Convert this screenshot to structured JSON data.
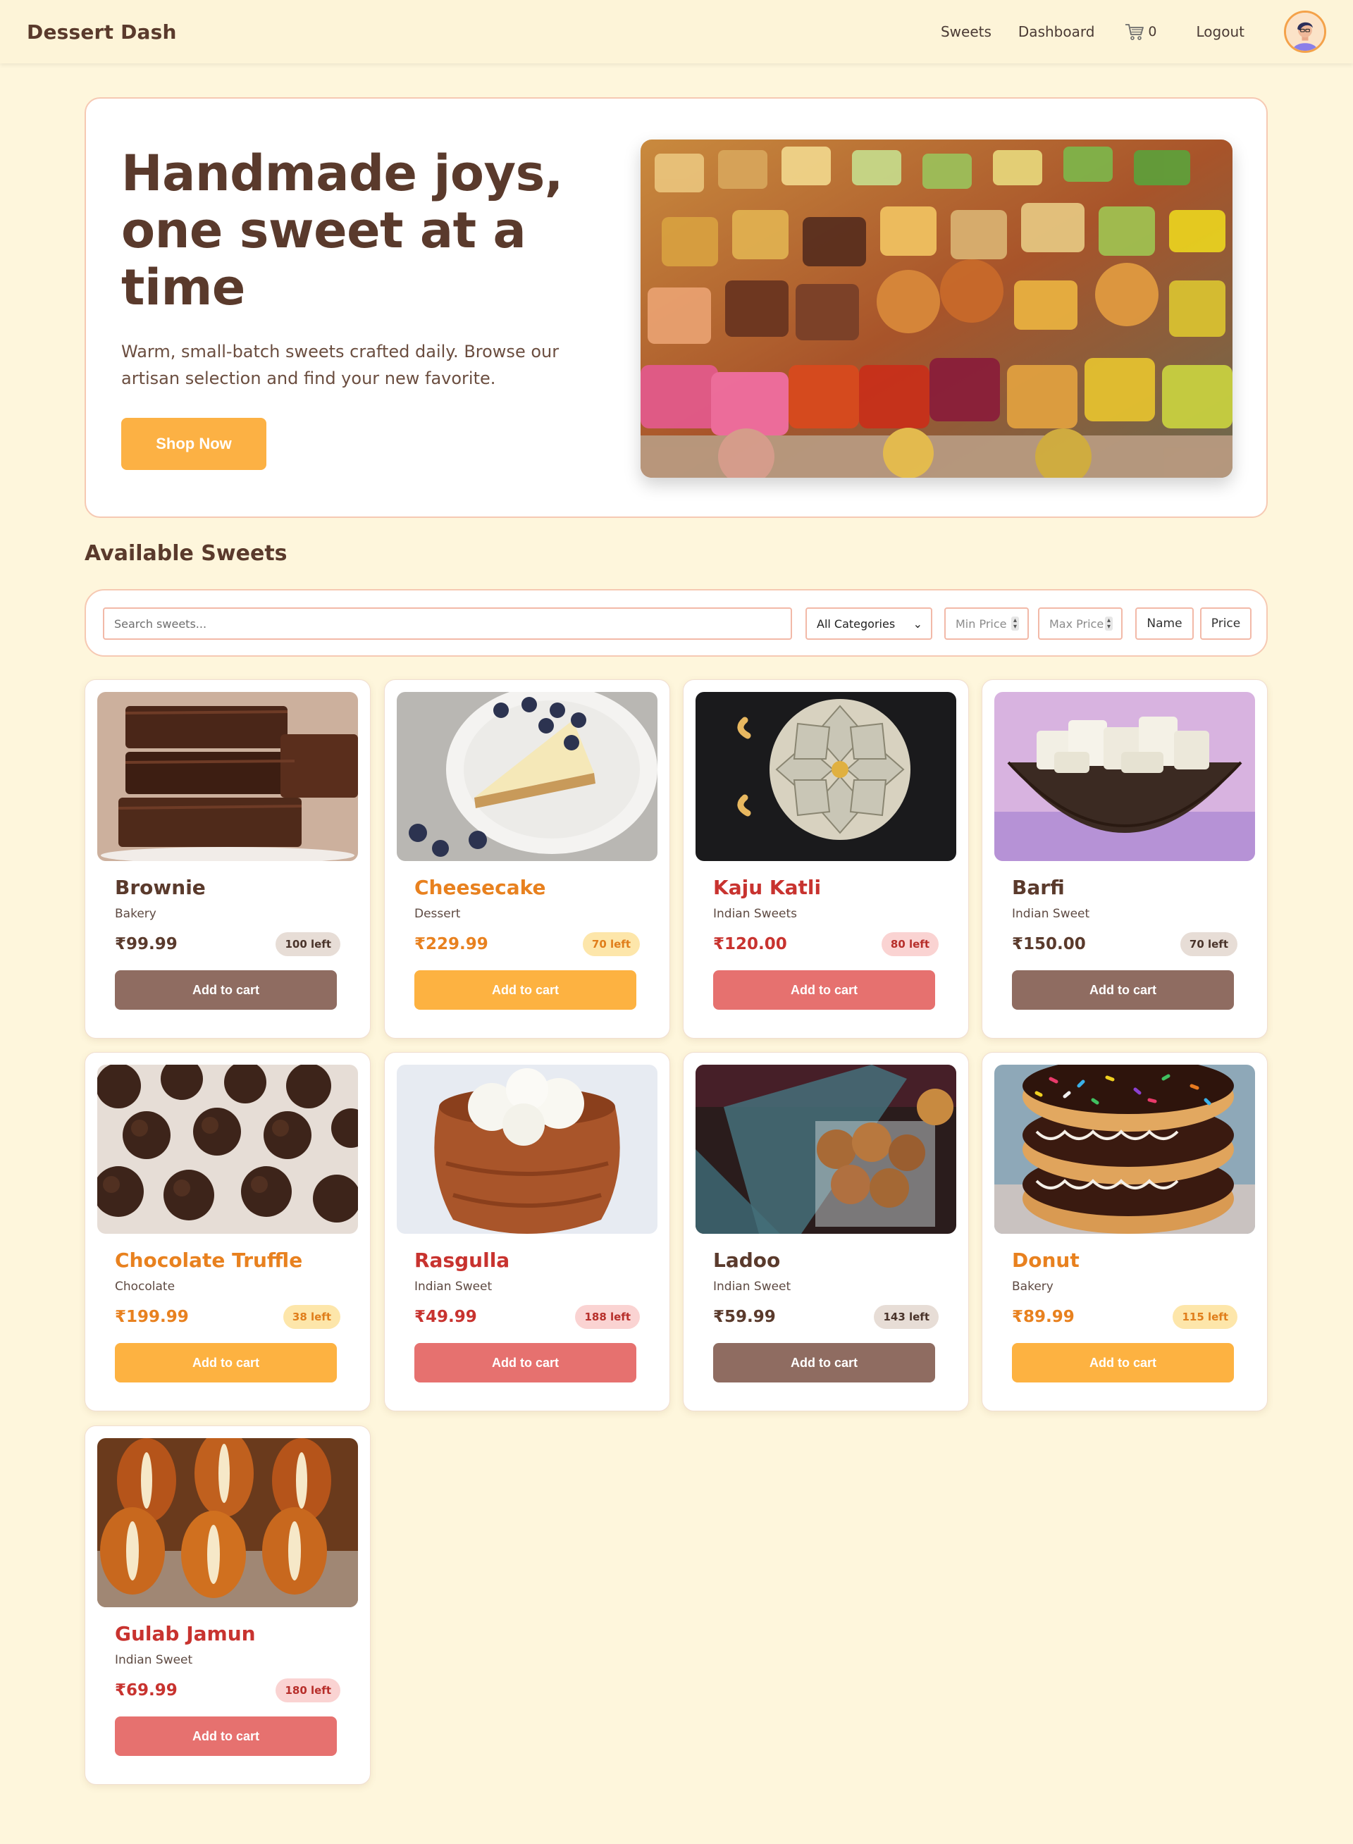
{
  "nav": {
    "brand": "Dessert Dash",
    "links": {
      "sweets": "Sweets",
      "dashboard": "Dashboard",
      "logout": "Logout"
    },
    "cart_count": "0",
    "cart_icon": "cart-icon",
    "avatar_icon": "user-avatar"
  },
  "hero": {
    "title": "Handmade joys, one sweet at a time",
    "subtitle": "Warm, small-batch sweets crafted daily. Browse our artisan selection and find your new favorite.",
    "cta": "Shop Now"
  },
  "section_title": "Available Sweets",
  "filters": {
    "search_placeholder": "Search sweets...",
    "category_selected": "All Categories",
    "min_price_placeholder": "Min Price",
    "max_price_placeholder": "Max Price",
    "sort_name": "Name",
    "sort_price": "Price"
  },
  "colors": {
    "background": "#fef6dc",
    "brown": "#8f6c61",
    "amber": "#fdb241",
    "red": "#e6716f",
    "dark_text": "#5a3a2c"
  },
  "products": [
    {
      "name": "Brownie",
      "category": "Bakery",
      "price": "₹99.99",
      "stock": "100 left",
      "button": "Add to cart"
    },
    {
      "name": "Cheesecake",
      "category": "Dessert",
      "price": "₹229.99",
      "stock": "70 left",
      "button": "Add to cart"
    },
    {
      "name": "Kaju Katli",
      "category": "Indian Sweets",
      "price": "₹120.00",
      "stock": "80 left",
      "button": "Add to cart"
    },
    {
      "name": "Barfi",
      "category": "Indian Sweet",
      "price": "₹150.00",
      "stock": "70 left",
      "button": "Add to cart"
    },
    {
      "name": "Chocolate Truffle",
      "category": "Chocolate",
      "price": "₹199.99",
      "stock": "38 left",
      "button": "Add to cart"
    },
    {
      "name": "Rasgulla",
      "category": "Indian Sweet",
      "price": "₹49.99",
      "stock": "188 left",
      "button": "Add to cart"
    },
    {
      "name": "Ladoo",
      "category": "Indian Sweet",
      "price": "₹59.99",
      "stock": "143 left",
      "button": "Add to cart"
    },
    {
      "name": "Donut",
      "category": "Bakery",
      "price": "₹89.99",
      "stock": "115 left",
      "button": "Add to cart"
    },
    {
      "name": "Gulab Jamun",
      "category": "Indian Sweet",
      "price": "₹69.99",
      "stock": "180 left",
      "button": "Add to cart"
    }
  ]
}
